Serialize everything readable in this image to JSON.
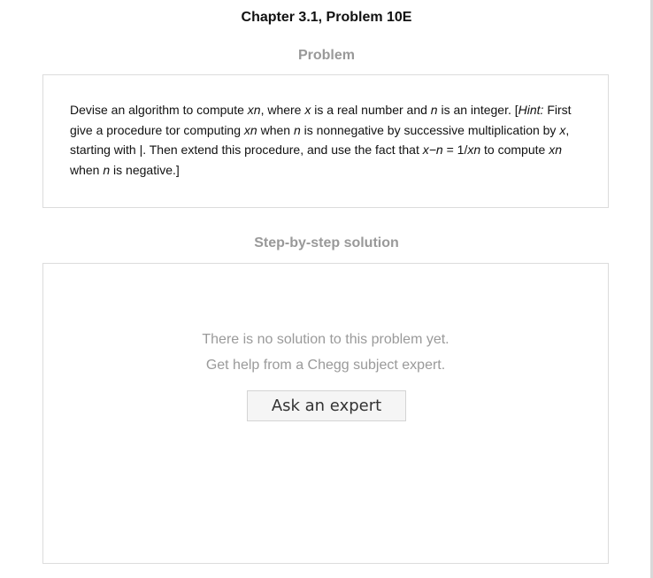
{
  "header": {
    "title": "Chapter 3.1, Problem 10E"
  },
  "problem": {
    "heading": "Problem",
    "text_parts": [
      "Devise an algorithm to compute ",
      "xn",
      ", where ",
      "x",
      " is a real number and ",
      "n",
      " is an integer. [",
      "Hint:",
      " First give a procedure tor computing ",
      "xn",
      " when ",
      "n",
      " is nonnegative by successive multiplication by ",
      "x",
      ", starting with |. Then extend this procedure, and use the fact that ",
      "x−n",
      " = 1/",
      "xn",
      " to compute ",
      "xn",
      " when ",
      "n",
      " is negative.]"
    ]
  },
  "solution": {
    "heading": "Step-by-step solution",
    "empty_line_1": "There is no solution to this problem yet.",
    "empty_line_2": "Get help from a Chegg subject expert.",
    "ask_button_label": "Ask an expert"
  }
}
